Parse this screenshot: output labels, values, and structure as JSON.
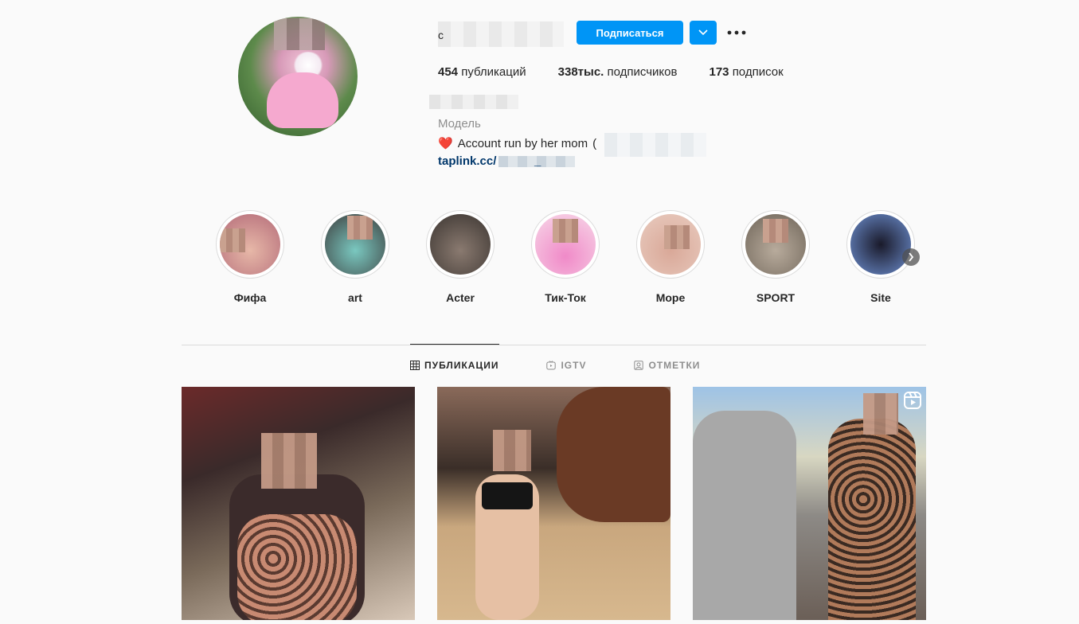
{
  "profile": {
    "username_visible_char": "c",
    "follow_label": "Подписаться",
    "stats": {
      "posts_count": "454",
      "posts_label": "публикаций",
      "followers_count": "338тыс.",
      "followers_label": "подписчиков",
      "following_count": "173",
      "following_label": "подписок"
    },
    "category": "Модель",
    "bio_emoji": "❤️",
    "bio_text": "Account run by her mom",
    "bio_text_trailing": "(",
    "link_text": "taplink.cc/",
    "link_underscore": "_"
  },
  "highlights": [
    {
      "label": "Фифа",
      "color": "#e7b8a8"
    },
    {
      "label": "art",
      "color": "#7ac8c0"
    },
    {
      "label": "Acter",
      "color": "#6a5e5a"
    },
    {
      "label": "Тик-Ток",
      "color": "#f08ac8"
    },
    {
      "label": "Море",
      "color": "#d9a898"
    },
    {
      "label": "SPORT",
      "color": "#b8ab9c"
    },
    {
      "label": "Site",
      "color": "#3b4c7a"
    }
  ],
  "tabs": [
    {
      "label": "ПУБЛИКАЦИИ",
      "icon": "grid-icon",
      "active": true
    },
    {
      "label": "IGTV",
      "icon": "igtv-icon",
      "active": false
    },
    {
      "label": "ОТМЕТКИ",
      "icon": "tagged-icon",
      "active": false
    }
  ],
  "colors": {
    "accent": "#0095f6",
    "link": "#00376b",
    "muted": "#8e8e8e",
    "text": "#262626"
  }
}
